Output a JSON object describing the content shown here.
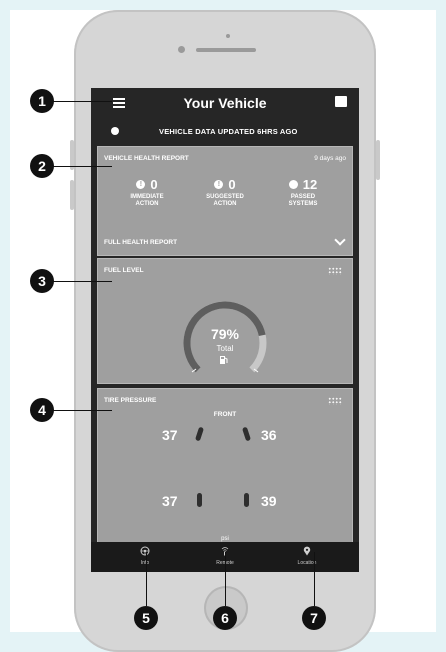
{
  "screen": {
    "title": "Your Vehicle",
    "status": "VEHICLE DATA UPDATED 6HRS AGO"
  },
  "health_report": {
    "title": "VEHICLE HEALTH REPORT",
    "age": "9 days ago",
    "stats": [
      {
        "value": "0",
        "label_line1": "IMMEDIATE",
        "label_line2": "ACTION",
        "icon": "exclamation-icon"
      },
      {
        "value": "0",
        "label_line1": "SUGGESTED",
        "label_line2": "ACTION",
        "icon": "exclamation-icon"
      },
      {
        "value": "12",
        "label_line1": "PASSED",
        "label_line2": "SYSTEMS",
        "icon": "check-icon"
      }
    ],
    "full_report_label": "FULL HEALTH REPORT"
  },
  "fuel": {
    "title": "FUEL LEVEL",
    "percent_text": "79%",
    "fraction": 0.79,
    "total_label": "Total"
  },
  "tire_pressure": {
    "title": "TIRE PRESSURE",
    "front_label": "FRONT",
    "front_left": "37",
    "front_right": "36",
    "rear_left": "37",
    "rear_right": "39",
    "unit": "psi"
  },
  "bottom_nav": [
    {
      "label": "Info",
      "icon": "steering-wheel-icon"
    },
    {
      "label": "Remote",
      "icon": "remote-signal-icon"
    },
    {
      "label": "Location",
      "icon": "location-pin-icon"
    }
  ],
  "callouts": [
    "1",
    "2",
    "3",
    "4",
    "5",
    "6",
    "7"
  ],
  "colors": {
    "background": "#e4f3f6",
    "screen": "#262626",
    "card": "#9f9f9f"
  }
}
